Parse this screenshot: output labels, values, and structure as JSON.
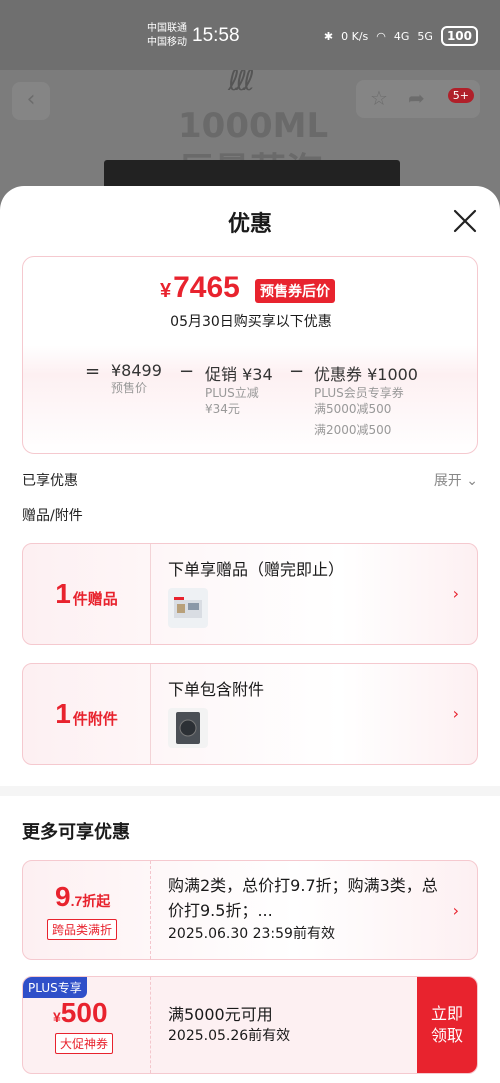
{
  "status_bar": {
    "carrier1": "中国联通",
    "carrier2": "中国移动",
    "time": "15:58",
    "net_speed": "0 K/s",
    "signal1": "4G",
    "signal2": "5G",
    "battery": "100"
  },
  "background": {
    "steam_text": "1000ML",
    "headline": "巨量蒸汽",
    "cart_badge": "5+"
  },
  "sheet": {
    "title": "优惠",
    "summary": {
      "final_price_symbol": "¥",
      "final_price": "7465",
      "final_price_tag": "预售券后价",
      "note": "05月30日购买享以下优惠",
      "equals": "=",
      "presale_price": "¥8499",
      "presale_label": "预售价",
      "minus1": "−",
      "promo_title": "促销 ¥34",
      "promo_desc1": "PLUS立减",
      "promo_desc2": "¥34元",
      "minus2": "−",
      "coupon_title": "优惠券 ¥1000",
      "coupon_desc1": "PLUS会员专享券",
      "coupon_desc2": "满5000减500",
      "coupon_desc3": "满2000减500"
    },
    "enjoyed_label": "已享优惠",
    "expand_label": "展开",
    "gift_section_label": "赠品/附件",
    "gift_card": {
      "count": "1",
      "unit": "件赠品",
      "title": "下单享赠品（赠完即止）"
    },
    "accessory_card": {
      "count": "1",
      "unit": "件附件",
      "title": "下单包含附件"
    },
    "more_title": "更多可享优惠",
    "discount_card": {
      "big": "9",
      "big_suffix": ".7折起",
      "tag": "跨品类满折",
      "text": "购满2类，总价打9.7折；购满3类，总价打9.5折；...",
      "date": "2025.06.30 23:59前有效"
    },
    "coupon_card": {
      "plus_label": "PLUS专享",
      "symbol": "¥",
      "amount": "500",
      "tag": "大促神券",
      "condition": "满5000元可用",
      "date": "2025.05.26前有效",
      "claim_label": "立即领取"
    }
  },
  "colors": {
    "accent": "#e8232e",
    "plus_blue": "#2f4fc9"
  }
}
